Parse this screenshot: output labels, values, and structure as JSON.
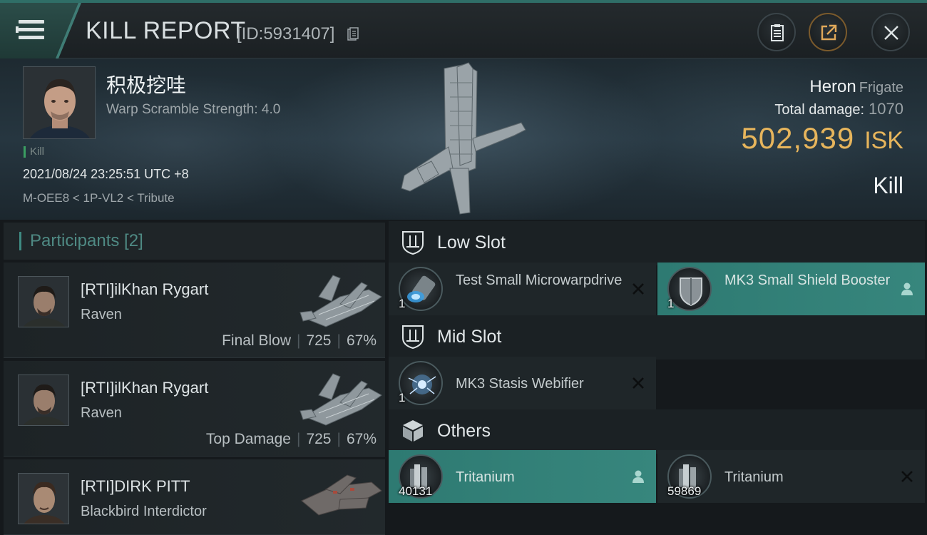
{
  "header": {
    "title": "KILL REPORT",
    "id_text": "[ID:5931407]"
  },
  "victim": {
    "name": "积极挖哇",
    "warp_scramble": "Warp Scramble Strength: 4.0",
    "tag": "Kill",
    "timestamp": "2021/08/24 23:25:51 UTC +8",
    "location": "M-OEE8 < 1P-VL2 < Tribute",
    "ship_name": "Heron",
    "ship_class": "Frigate",
    "total_damage_label": "Total damage:",
    "total_damage": "1070",
    "isk_value": "502,939",
    "isk_unit": "ISK",
    "result": "Kill"
  },
  "participants": {
    "title": "Participants [2]",
    "rows": [
      {
        "name": "[RTI]ilKhan Rygart",
        "ship": "Raven",
        "role": "Final Blow",
        "damage": "725",
        "percent": "67%"
      },
      {
        "name": "[RTI]ilKhan Rygart",
        "ship": "Raven",
        "role": "Top Damage",
        "damage": "725",
        "percent": "67%"
      },
      {
        "name": "[RTI]DIRK PITT",
        "ship": "Blackbird Interdictor"
      }
    ]
  },
  "slots": {
    "low": {
      "title": "Low Slot",
      "items": [
        {
          "name": "Test Small Microwarpdrive",
          "qty": "1",
          "status": "destroyed"
        },
        {
          "name": "MK3 Small Shield Booster",
          "qty": "1",
          "status": "dropped"
        }
      ]
    },
    "mid": {
      "title": "Mid Slot",
      "items": [
        {
          "name": "MK3 Stasis Webifier",
          "qty": "1",
          "status": "destroyed"
        }
      ]
    },
    "others": {
      "title": "Others",
      "items": [
        {
          "name": "Tritanium",
          "qty": "40131",
          "status": "dropped"
        },
        {
          "name": "Tritanium",
          "qty": "59869",
          "status": "destroyed"
        }
      ]
    }
  },
  "colors": {
    "accent_teal": "#37867d",
    "isk_gold": "#e7b55c",
    "kill_green": "#3b9e62",
    "background": "#15191c"
  },
  "icons": {
    "menu": "hamburger-icon",
    "copy": "copy-icon",
    "clipboard": "clipboard-icon",
    "share": "share-icon",
    "close": "close-icon"
  }
}
